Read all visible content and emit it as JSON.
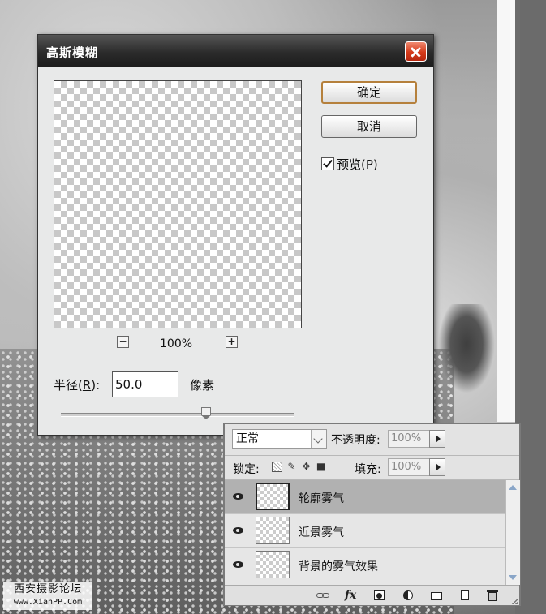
{
  "watermark": {
    "title": "西安摄影论坛",
    "url": "www.XianPP.Com"
  },
  "dialog": {
    "title": "高斯模糊",
    "ok_label": "确定",
    "cancel_label": "取消",
    "preview_label": "预览(",
    "preview_key": "P",
    "preview_close": ")",
    "preview_checked": true,
    "zoom_out": "−",
    "zoom_in": "+",
    "zoom_level": "100%",
    "radius_label_pre": "半径(",
    "radius_key": "R",
    "radius_label_post": "):",
    "radius_value": "50.0",
    "radius_unit": "像素",
    "slider_position": 0.62
  },
  "layers_panel": {
    "blend_mode": "正常",
    "opacity_label": "不透明度:",
    "opacity_value": "100%",
    "lock_label": "锁定:",
    "fill_label": "填充:",
    "fill_value": "100%",
    "layers": [
      {
        "name": "轮廓雾气",
        "visible": true,
        "selected": true
      },
      {
        "name": "近景雾气",
        "visible": true,
        "selected": false
      },
      {
        "name": "背景的雾气效果",
        "visible": true,
        "selected": false
      }
    ],
    "footer_fx": "fx"
  }
}
